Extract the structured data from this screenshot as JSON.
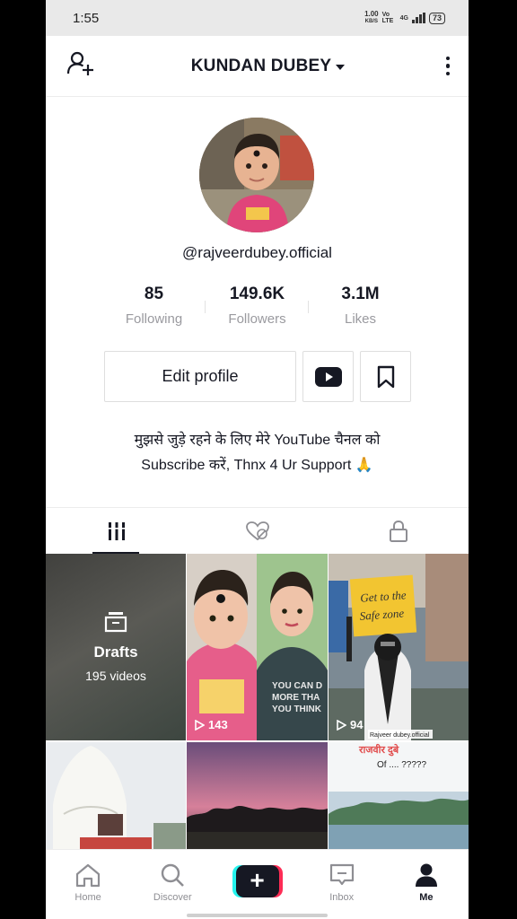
{
  "status_bar": {
    "time": "1:55",
    "net_speed": "1.00",
    "net_unit": "KB/S",
    "net_type": "Vo LTE",
    "signal": "4G",
    "battery": "73"
  },
  "header": {
    "title": "KUNDAN DUBEY",
    "icons": [
      "add-user-icon",
      "chevron-down-icon",
      "more-vertical-icon"
    ]
  },
  "profile": {
    "username": "@rajveerdubey.official",
    "stats": [
      {
        "value": "85",
        "label": "Following"
      },
      {
        "value": "149.6K",
        "label": "Followers"
      },
      {
        "value": "3.1M",
        "label": "Likes"
      }
    ],
    "edit_label": "Edit profile",
    "bio_line1": "मुझसे जुड़े रहने के लिए मेरे YouTube चैनल को",
    "bio_line2": "Subscribe करें, Thnx 4 Ur Support 🙏"
  },
  "tabs": [
    {
      "name": "videos",
      "icon": "grid-icon",
      "active": true
    },
    {
      "name": "liked",
      "icon": "liked-hidden-icon",
      "active": false
    },
    {
      "name": "private",
      "icon": "lock-icon",
      "active": false
    }
  ],
  "videos": {
    "drafts_label": "Drafts",
    "drafts_count": "195 videos",
    "items": [
      {
        "play_count": "143"
      },
      {
        "play_count": "94"
      }
    ],
    "thumb_text": {
      "sign_line1": "Get to the",
      "sign_line2": "Safe zone",
      "watermark": "Rajveer dubey.official",
      "caption_hindi": "राजवीर दुबे",
      "caption": "Of .... ?????"
    }
  },
  "bottom_nav": [
    {
      "label": "Home",
      "icon": "home-icon"
    },
    {
      "label": "Discover",
      "icon": "search-icon"
    },
    {
      "label": "",
      "icon": "create-plus-icon"
    },
    {
      "label": "Inbox",
      "icon": "inbox-icon"
    },
    {
      "label": "Me",
      "icon": "profile-icon"
    }
  ],
  "colors": {
    "text": "#161823",
    "muted": "#9a9a9f",
    "accent_cyan": "#25f4ee",
    "accent_pink": "#fe2c55"
  }
}
